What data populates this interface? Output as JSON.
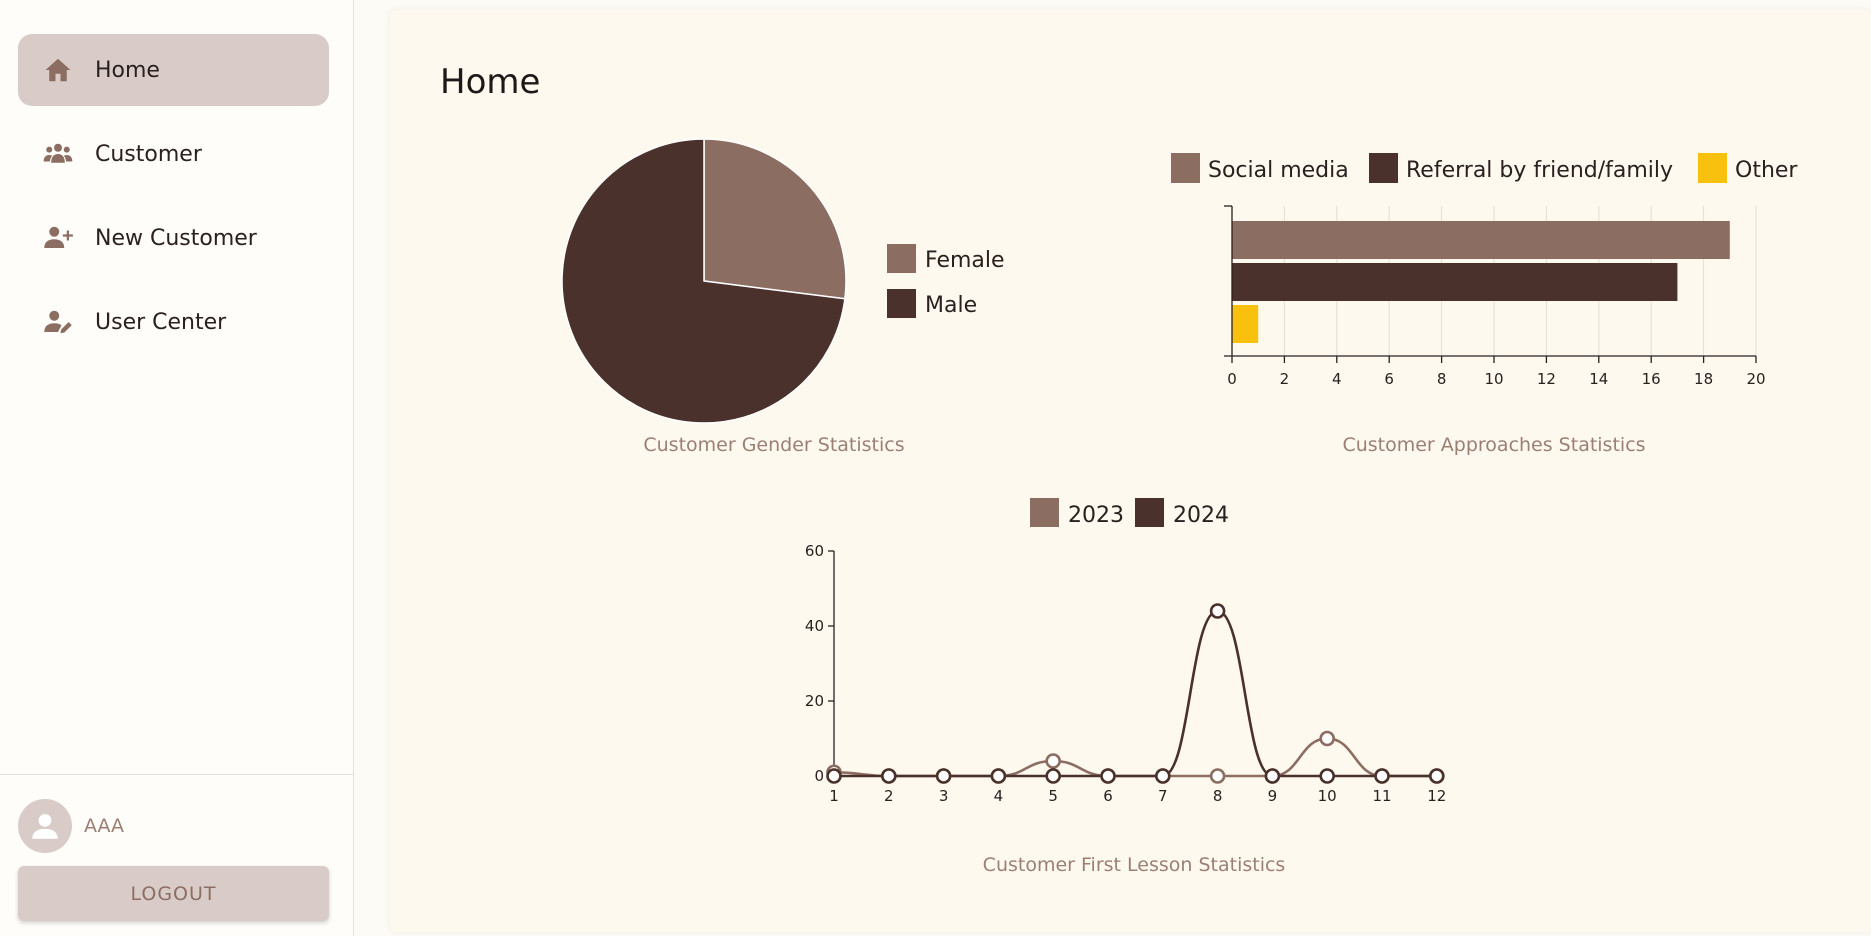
{
  "sidebar": {
    "items": [
      {
        "label": "Home",
        "icon": "home-icon",
        "active": true
      },
      {
        "label": "Customer",
        "icon": "users-icon",
        "active": false
      },
      {
        "label": "New Customer",
        "icon": "user-plus-icon",
        "active": false
      },
      {
        "label": "User Center",
        "icon": "user-edit-icon",
        "active": false
      }
    ],
    "user": {
      "name": "AAA"
    },
    "logout_label": "LOGOUT"
  },
  "main": {
    "title": "Home"
  },
  "colors": {
    "series1": "#8c6d61",
    "series2": "#4a312c",
    "series3": "#f8c10e",
    "accent": "#d9ccc8"
  },
  "chart_data": [
    {
      "type": "pie",
      "title": "Customer Gender Statistics",
      "categories": [
        "Female",
        "Male"
      ],
      "values": [
        27,
        73
      ],
      "legend_position": "right"
    },
    {
      "type": "bar",
      "orientation": "horizontal",
      "title": "Customer Approaches Statistics",
      "categories": [
        "Social media",
        "Referral by friend/family",
        "Other"
      ],
      "values": [
        19,
        17,
        1
      ],
      "xlim": [
        0,
        20
      ],
      "xticks": [
        0,
        2,
        4,
        6,
        8,
        10,
        12,
        14,
        16,
        18,
        20
      ],
      "grid": true,
      "legend_position": "top"
    },
    {
      "type": "line",
      "title": "Customer First Lesson Statistics",
      "x": [
        1,
        2,
        3,
        4,
        5,
        6,
        7,
        8,
        9,
        10,
        11,
        12
      ],
      "series": [
        {
          "name": "2023",
          "values": [
            1,
            0,
            0,
            0,
            4,
            0,
            0,
            0,
            0,
            10,
            0,
            0
          ]
        },
        {
          "name": "2024",
          "values": [
            0,
            0,
            0,
            0,
            0,
            0,
            0,
            44,
            0,
            0,
            0,
            0
          ]
        }
      ],
      "ylim": [
        0,
        60
      ],
      "yticks": [
        0,
        20,
        40,
        60
      ],
      "smooth": true,
      "legend_position": "top"
    }
  ]
}
